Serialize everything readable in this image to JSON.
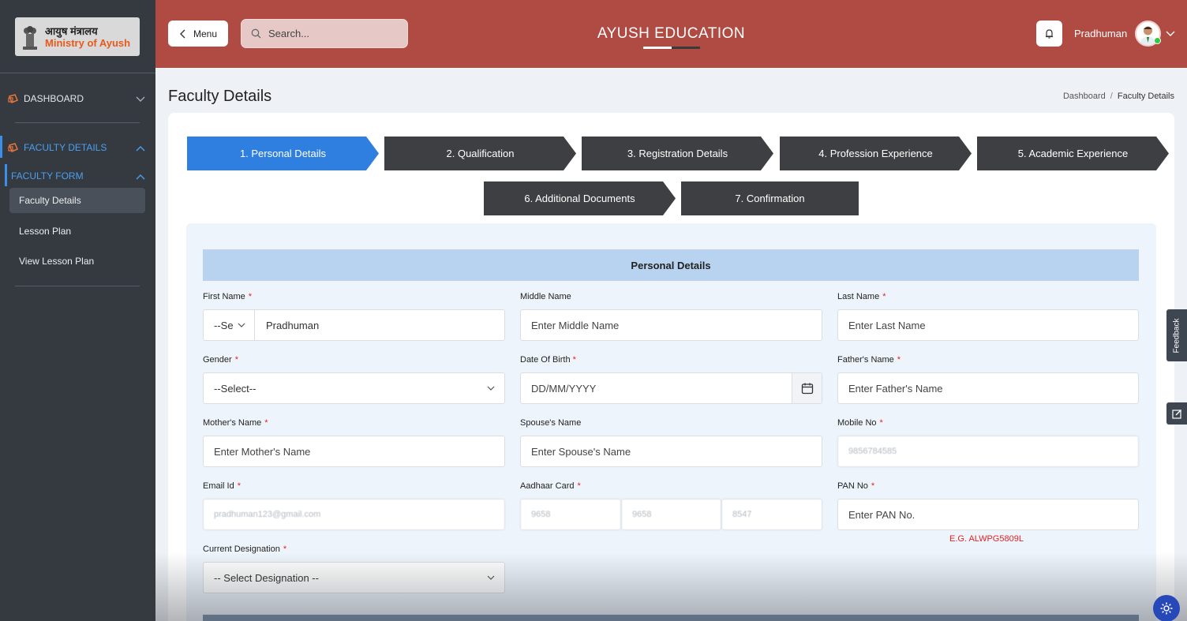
{
  "logo": {
    "hindi": "आयुष मंत्रालय",
    "english": "Ministry of Ayush"
  },
  "sidebar": {
    "dashboard": "DASHBOARD",
    "faculty_details": "FACULTY DETAILS",
    "faculty_form": "FACULTY FORM",
    "items": [
      "Faculty Details",
      "Lesson Plan",
      "View Lesson Plan"
    ]
  },
  "header": {
    "menu_label": "Menu",
    "search_placeholder": "Search...",
    "app_title": "AYUSH EDUCATION",
    "user_name": "Pradhuman"
  },
  "page": {
    "title": "Faculty Details",
    "breadcrumb": [
      "Dashboard",
      "Faculty Details"
    ]
  },
  "steps": [
    "1. Personal Details",
    "2. Qualification",
    "3. Registration Details",
    "4. Profession Experience",
    "5. Academic Experience",
    "6. Additional Documents",
    "7. Confirmation"
  ],
  "form": {
    "section_title": "Personal Details",
    "first_name": {
      "label": "First Name",
      "prefix": "--Se",
      "value": "Pradhuman"
    },
    "middle_name": {
      "label": "Middle Name",
      "placeholder": "Enter Middle Name"
    },
    "last_name": {
      "label": "Last Name",
      "placeholder": "Enter Last Name"
    },
    "gender": {
      "label": "Gender",
      "value": "--Select--"
    },
    "dob": {
      "label": "Date Of Birth",
      "placeholder": "DD/MM/YYYY"
    },
    "father_name": {
      "label": "Father's Name",
      "placeholder": "Enter Father's Name"
    },
    "mother_name": {
      "label": "Mother's Name",
      "placeholder": "Enter Mother's Name"
    },
    "spouse_name": {
      "label": "Spouse's Name",
      "placeholder": "Enter Spouse's Name"
    },
    "mobile": {
      "label": "Mobile No",
      "value": "9856784585"
    },
    "email": {
      "label": "Email Id",
      "value": "pradhuman123@gmail.com"
    },
    "aadhaar": {
      "label": "Aadhaar Card",
      "parts": [
        "9658",
        "9658",
        "8547"
      ]
    },
    "pan": {
      "label": "PAN No",
      "placeholder": "Enter PAN No.",
      "hint": "E.G. ALWPG5809L"
    },
    "designation": {
      "label": "Current Designation",
      "value": "-- Select Designation --"
    }
  },
  "feedback_label": "Feedback",
  "colors": {
    "header": "#b04b43",
    "sidebar": "#353a41",
    "step_active": "#2f7fe0",
    "step_inactive": "#3d3f42",
    "required": "#e02424"
  }
}
